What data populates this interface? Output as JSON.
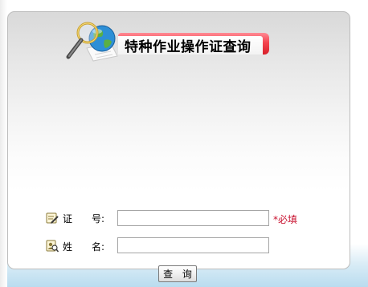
{
  "header": {
    "title": "特种作业操作证查询"
  },
  "form": {
    "cert_label": "证　　号:",
    "cert_value": "",
    "cert_required": "*必填",
    "name_label": "姓　　名:",
    "name_value": ""
  },
  "actions": {
    "query_label": "查 询"
  },
  "icons": {
    "header": "magnifier-globe-icon",
    "cert": "edit-card-icon",
    "name": "user-search-icon"
  },
  "colors": {
    "banner_accent": "#e8323c",
    "required": "#c8102e"
  }
}
